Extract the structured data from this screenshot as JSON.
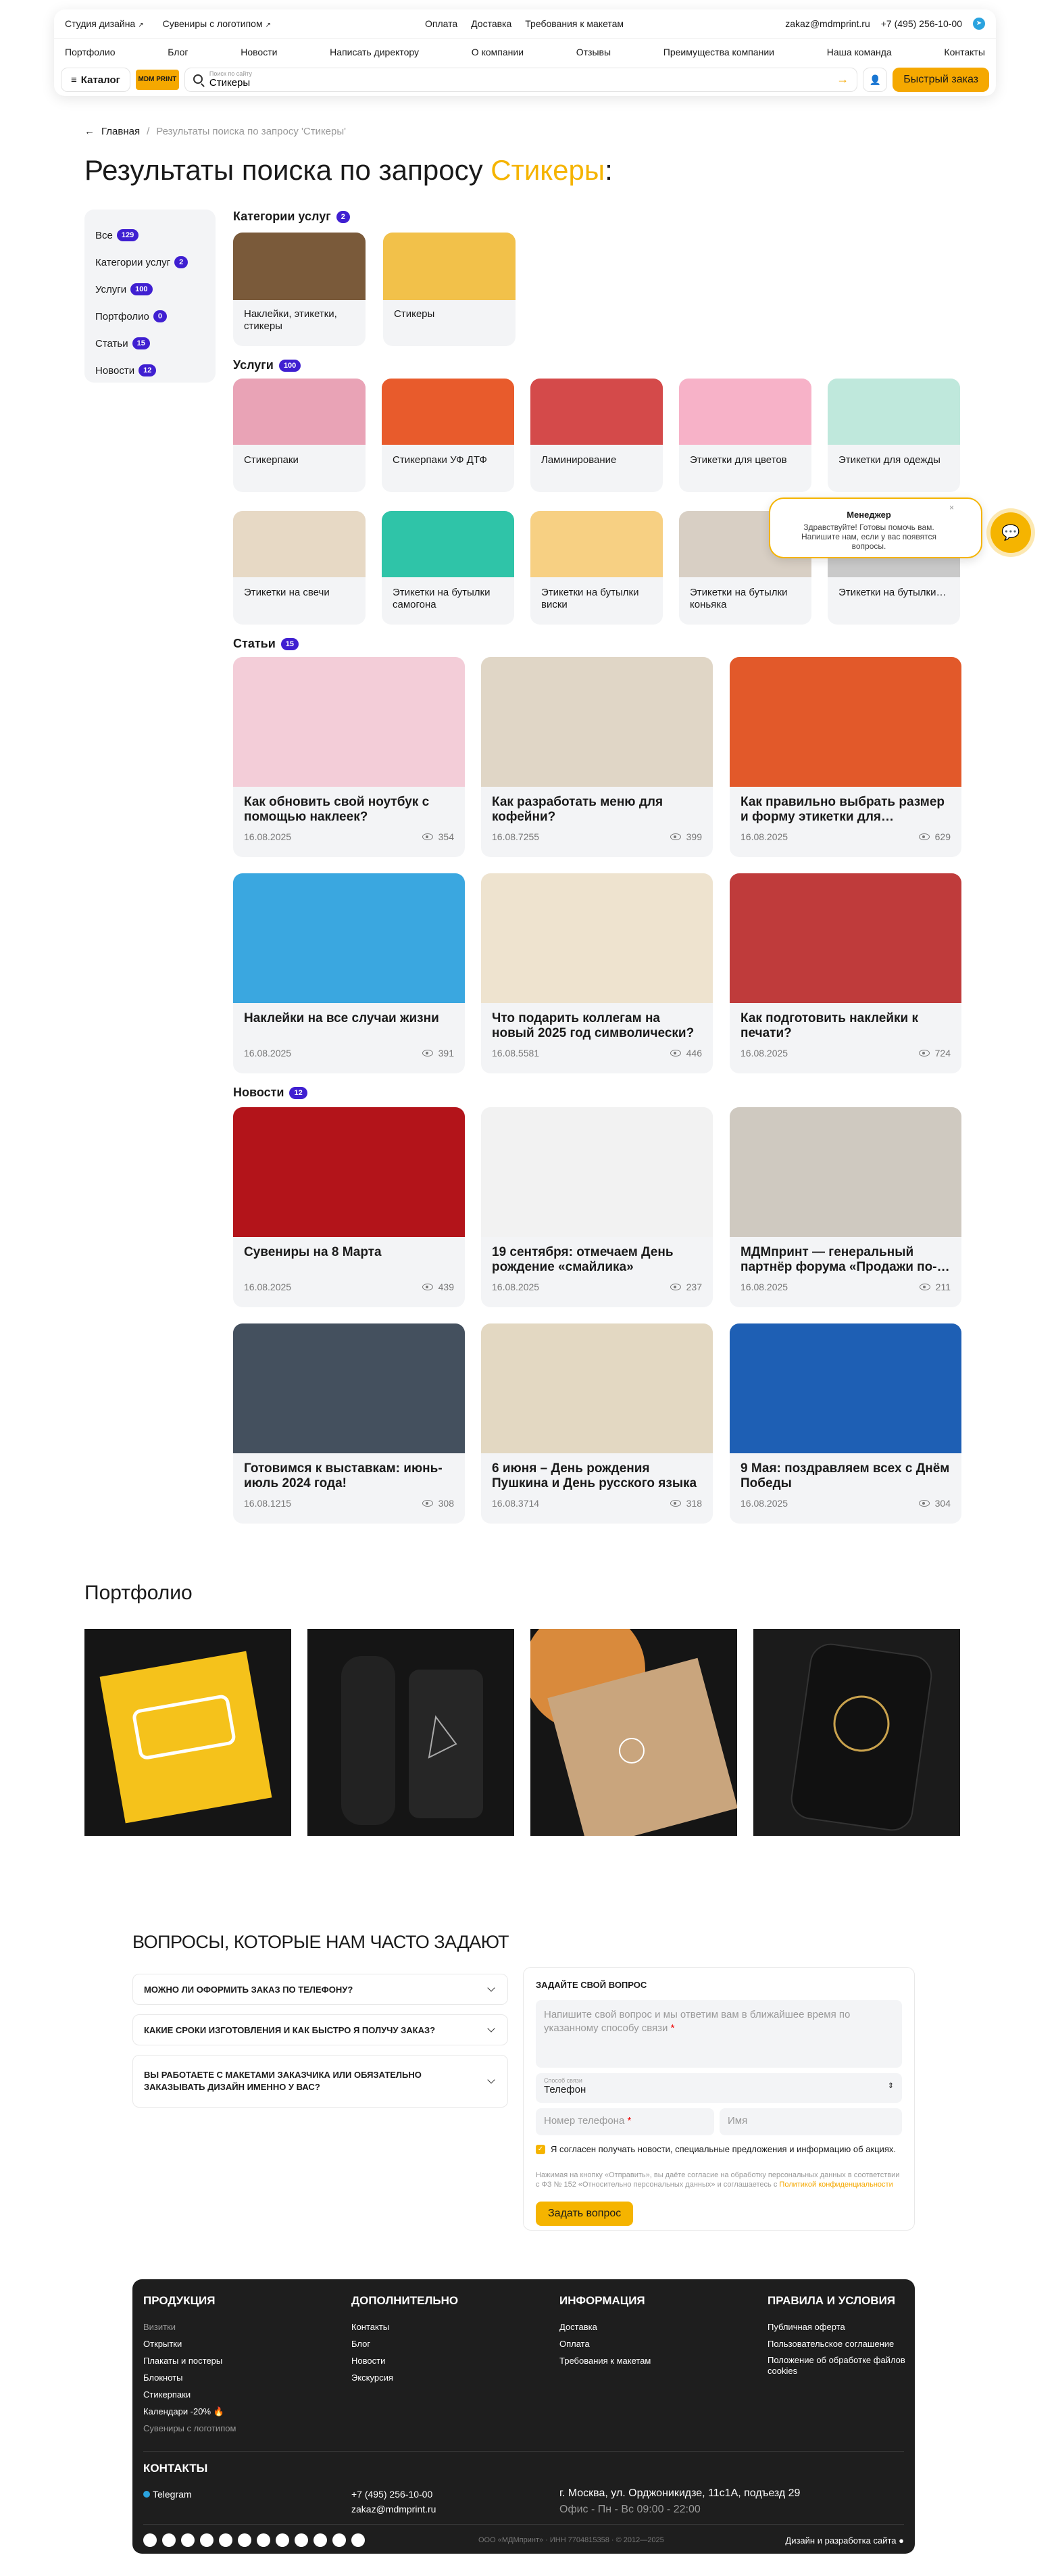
{
  "header": {
    "top_left": [
      "Студия дизайна",
      "Сувениры с логотипом"
    ],
    "top_mid": [
      "Оплата",
      "Доставка",
      "Требования к макетам"
    ],
    "email": "zakaz@mdmprint.ru",
    "phone": "+7 (495) 256-10-00",
    "nav": [
      "Портфолио",
      "Блог",
      "Новости",
      "Написать директору",
      "О компании",
      "Отзывы",
      "Преимущества компании",
      "Наша команда",
      "Контакты"
    ],
    "catalog_label": "Каталог",
    "logo_text": "MDM PRINT",
    "search_hint": "Поиск по сайту",
    "search_value": "Стикеры",
    "quick_order": "Быстрый заказ"
  },
  "breadcrumb": {
    "home": "Главная",
    "separator": "/",
    "current": "Результаты поиска по запросу 'Стикеры'"
  },
  "title": {
    "prefix": "Результаты поиска по запросу ",
    "query": "Стикеры",
    "suffix": ":"
  },
  "filters": [
    {
      "label": "Все",
      "count": "129"
    },
    {
      "label": "Категории услуг",
      "count": "2"
    },
    {
      "label": "Услуги",
      "count": "100"
    },
    {
      "label": "Портфолио",
      "count": "0"
    },
    {
      "label": "Статьи",
      "count": "15"
    },
    {
      "label": "Новости",
      "count": "12"
    }
  ],
  "sections": {
    "categories": {
      "label": "Категории услуг",
      "count": "2"
    },
    "services": {
      "label": "Услуги",
      "count": "100"
    },
    "articles": {
      "label": "Статьи",
      "count": "15"
    },
    "news": {
      "label": "Новости",
      "count": "12"
    }
  },
  "categories": [
    {
      "title": "Наклейки, этикетки, стикеры",
      "color": "#7a5a3a"
    },
    {
      "title": "Стикеры",
      "color": "#f2c14a"
    }
  ],
  "services": [
    {
      "title": "Стикерпаки",
      "color": "#e9a3b6"
    },
    {
      "title": "Стикерпаки УФ ДТФ",
      "color": "#e85b2c"
    },
    {
      "title": "Ламинирование",
      "color": "#d44a4a"
    },
    {
      "title": "Этикетки для цветов",
      "color": "#f7b2c8"
    },
    {
      "title": "Этикетки для одежды",
      "color": "#bfe8dc"
    },
    {
      "title": "Этикетки на свечи",
      "color": "#e7d9c5"
    },
    {
      "title": "Этикетки на бутылки самогона",
      "color": "#2fc4a8"
    },
    {
      "title": "Этикетки на бутылки виски",
      "color": "#f7d083"
    },
    {
      "title": "Этикетки на бутылки коньяка",
      "color": "#d8cfc4"
    },
    {
      "title": "Этикетки на бутылки…",
      "color": "#c9c9c9"
    }
  ],
  "chat": {
    "manager": "Менеджер",
    "message": "Здравствуйте! Готовы помочь вам. Напишите нам, если у вас появятся вопросы.",
    "close": "×"
  },
  "articles": [
    {
      "title": "Как обновить свой ноутбук с помощью наклеек?",
      "date": "16.08.2025",
      "views": "354",
      "color": "#f3cdd8"
    },
    {
      "title": "Как разработать меню для кофейни?",
      "date": "16.08.7255",
      "views": "399",
      "color": "#e0d6c6"
    },
    {
      "title": "Как правильно выбрать размер и форму этикетки для…",
      "date": "16.08.2025",
      "views": "629",
      "color": "#e2592a"
    },
    {
      "title": "Наклейки на все случаи жизни",
      "date": "16.08.2025",
      "views": "391",
      "color": "#3aa7e0"
    },
    {
      "title": "Что подарить коллегам на новый 2025 год символически?",
      "date": "16.08.5581",
      "views": "446",
      "color": "#eee3cf"
    },
    {
      "title": "Как подготовить наклейки к печати?",
      "date": "16.08.2025",
      "views": "724",
      "color": "#bf3b3b"
    }
  ],
  "news": [
    {
      "title": "Сувениры на 8 Марта",
      "date": "16.08.2025",
      "views": "439",
      "color": "#b3141a"
    },
    {
      "title": "19 сентября: отмечаем День рождение «смайлика»",
      "date": "16.08.2025",
      "views": "237",
      "color": "#f2f2f2"
    },
    {
      "title": "МДМпринт — генеральный партнёр форума «Продажи по-…",
      "date": "16.08.2025",
      "views": "211",
      "color": "#cfc9c0"
    },
    {
      "title": "Готовимся к выставкам: июнь-июль 2024 года!",
      "date": "16.08.1215",
      "views": "308",
      "color": "#44505e"
    },
    {
      "title": "6 июня – День рождения Пушкина и День русского языка",
      "date": "16.08.3714",
      "views": "318",
      "color": "#e3d8c2"
    },
    {
      "title": "9 Мая: поздравляем всех с Днём Победы",
      "date": "16.08.2025",
      "views": "304",
      "color": "#1e5fb4"
    }
  ],
  "portfolio": {
    "title": "Портфолио",
    "items": [
      {
        "color": "#f5c21b"
      },
      {
        "color": "#151515"
      },
      {
        "color": "#d98a3c"
      },
      {
        "color": "#1b1b1b"
      }
    ]
  },
  "faq": {
    "title": "ВОПРОСЫ, КОТОРЫЕ НАМ ЧАСТО ЗАДАЮТ",
    "items": [
      "МОЖНО ЛИ ОФОРМИТЬ ЗАКАЗ ПО ТЕЛЕФОНУ?",
      "КАКИЕ СРОКИ ИЗГОТОВЛЕНИЯ И КАК БЫСТРО Я ПОЛУЧУ ЗАКАЗ?",
      "ВЫ РАБОТАЕТЕ С МАКЕТАМИ ЗАКАЗЧИКА ИЛИ ОБЯЗАТЕЛЬНО ЗАКАЗЫВАТЬ ДИЗАЙН ИМЕННО У ВАС?"
    ]
  },
  "form": {
    "title": "ЗАДАЙТЕ СВОЙ ВОПРОС",
    "question_placeholder": "Напишите свой вопрос и мы ответим вам в ближайшее время по указанному способу связи",
    "contact_label": "Способ связи",
    "contact_value": "Телефон",
    "phone_placeholder": "Номер телефона",
    "name_placeholder": "Имя",
    "consent": "Я согласен получать новости, специальные предложения и информацию об акциях.",
    "legal": "Нажимая на кнопку «Отправить», вы даёте согласие на обработку персональных данных в соответствии с ФЗ № 152 «Относительно персональных данных» и соглашаетесь с",
    "legal_link": "Политикой конфиденциальности",
    "submit": "Задать вопрос"
  },
  "footer": {
    "columns": [
      {
        "title": "ПРОДУКЦИЯ",
        "links": [
          "Визитки",
          "Открытки",
          "Плакаты и постеры",
          "Блокноты",
          "Стикерпаки",
          "Календари -20% 🔥",
          "Сувениры с логотипом"
        ]
      },
      {
        "title": "ДОПОЛНИТЕЛЬНО",
        "links": [
          "Контакты",
          "Блог",
          "Новости",
          "Экскурсия"
        ]
      },
      {
        "title": "ИНФОРМАЦИЯ",
        "links": [
          "Доставка",
          "Оплата",
          "Требования к макетам"
        ]
      },
      {
        "title": "ПРАВИЛА И УСЛОВИЯ",
        "links": [
          "Публичная оферта",
          "Пользовательское соглашение",
          "Положение об обработке файлов cookies"
        ]
      }
    ],
    "contacts_title": "КОНТАКТЫ",
    "telegram": "Telegram",
    "phone": "+7 (495) 256-10-00",
    "email": "zakaz@mdmprint.ru",
    "address": "г. Москва, ул. Орджоникидзе, 11с1А, подъезд 29",
    "hours": "Офис - Пн - Вс 09:00 - 22:00",
    "copyright": "ООО «МДМпринт» · ИНН 7704815358 · © 2012—2025",
    "dev": "Дизайн и разработка сайта"
  }
}
